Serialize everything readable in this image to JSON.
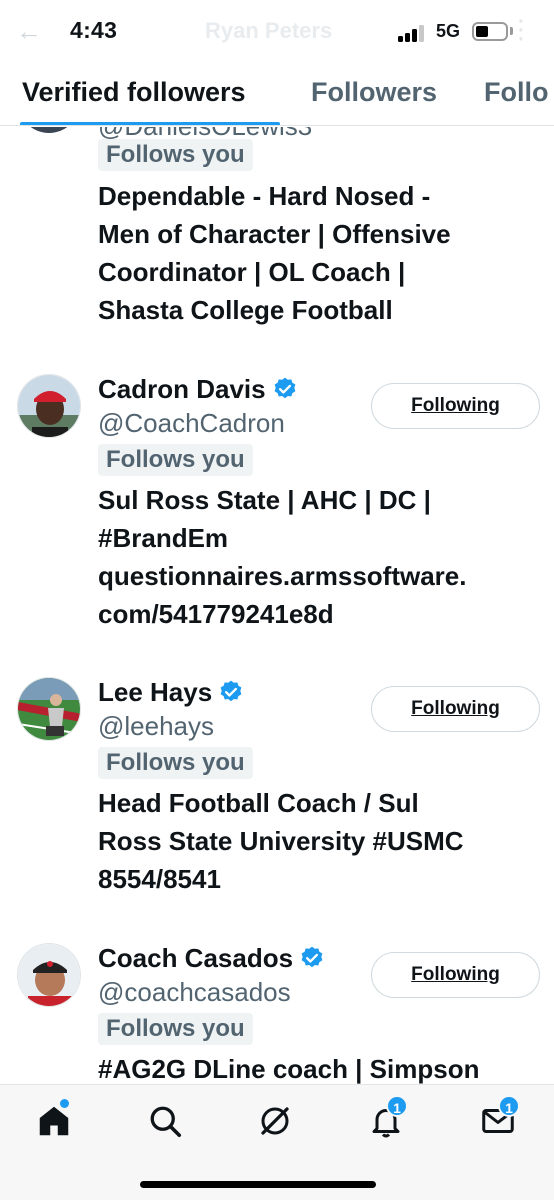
{
  "status_bar": {
    "time": "4:43",
    "network": "5G",
    "ghost_title": "Ryan Peters"
  },
  "tabs": [
    {
      "label": "Verified followers",
      "active": true
    },
    {
      "label": "Followers",
      "active": false
    },
    {
      "label": "Follo",
      "active": false
    }
  ],
  "colors": {
    "accent": "#1d9bf0",
    "verified": "#1d9bf0",
    "text_primary": "#0f1419",
    "text_secondary": "#536471"
  },
  "partial_user": {
    "handle": "@DanielsOLewis3",
    "follows_you": "Follows you",
    "bio_lines": [
      "Dependable - Hard Nosed -",
      "Men of Character | Offensive",
      "Coordinator | OL Coach |",
      "Shasta College Football"
    ]
  },
  "users": [
    {
      "name": "Cadron Davis",
      "handle": "@CoachCadron",
      "follows_you": "Follows you",
      "button": "Following",
      "bio_lines": [
        "Sul Ross State | AHC | DC |",
        "#BrandEm",
        "questionnaires.armssoftware.",
        "com/541779241e8d"
      ]
    },
    {
      "name": "Lee Hays",
      "handle": "@leehays",
      "follows_you": "Follows you",
      "button": "Following",
      "bio_lines": [
        "Head Football Coach / Sul",
        "Ross State University #USMC",
        "8554/8541"
      ]
    },
    {
      "name": "Coach Casados",
      "handle": "@coachcasados",
      "follows_you": "Follows you",
      "button": "Following",
      "bio_lines": [
        "#AG2G DLine coach | Simpson"
      ]
    }
  ],
  "bottom_nav": {
    "items": [
      {
        "icon": "home-icon"
      },
      {
        "icon": "search-icon"
      },
      {
        "icon": "grok-icon"
      },
      {
        "icon": "bell-icon",
        "badge": "1"
      },
      {
        "icon": "mail-icon",
        "badge": "1"
      }
    ]
  }
}
